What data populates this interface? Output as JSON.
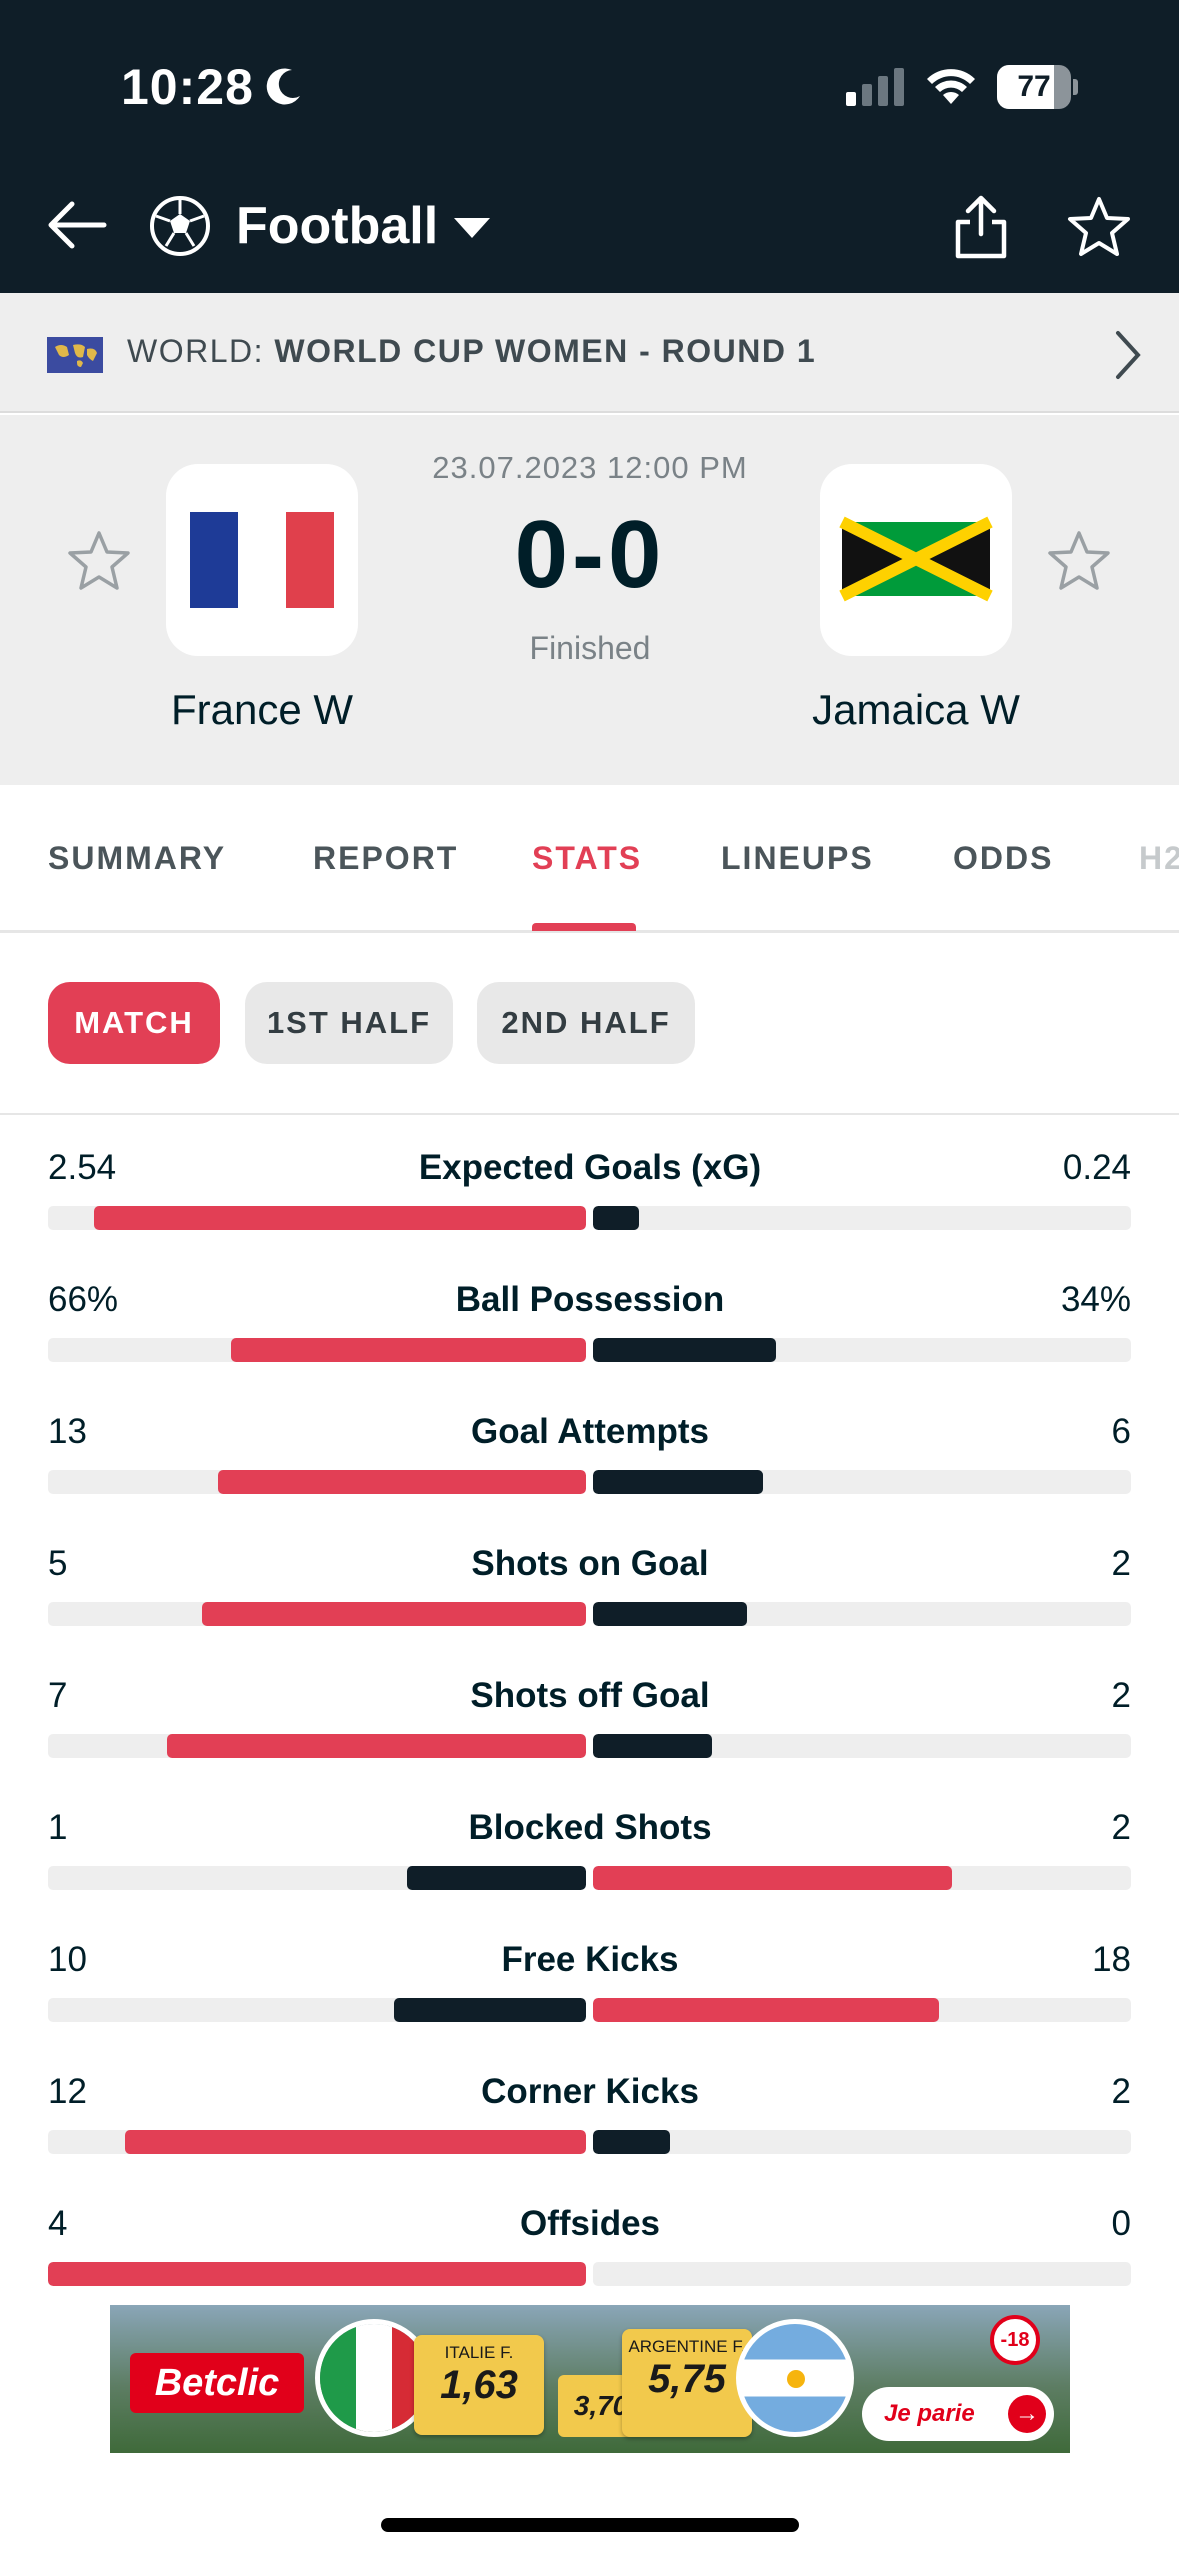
{
  "status_bar": {
    "time": "10:28",
    "battery": "77",
    "battery_level": 0.77
  },
  "header": {
    "sport": "Football"
  },
  "league": {
    "prefix": "WORLD:",
    "name": "WORLD CUP WOMEN - ROUND 1"
  },
  "match": {
    "date": "23.07.2023 12:00 PM",
    "score": "0-0",
    "status": "Finished",
    "home": {
      "name": "France W"
    },
    "away": {
      "name": "Jamaica W"
    }
  },
  "tabs": [
    {
      "label": "SUMMARY"
    },
    {
      "label": "REPORT"
    },
    {
      "label": "STATS"
    },
    {
      "label": "LINEUPS"
    },
    {
      "label": "ODDS"
    },
    {
      "label": "H2"
    }
  ],
  "periods": [
    {
      "label": "MATCH"
    },
    {
      "label": "1ST HALF"
    },
    {
      "label": "2ND HALF"
    }
  ],
  "stats": [
    {
      "label": "Expected Goals (xG)",
      "home": "2.54",
      "away": "0.24",
      "home_share": 0.914,
      "away_share": 0.086
    },
    {
      "label": "Ball Possession",
      "home": "66%",
      "away": "34%",
      "home_share": 0.66,
      "away_share": 0.34
    },
    {
      "label": "Goal Attempts",
      "home": "13",
      "away": "6",
      "home_share": 0.684,
      "away_share": 0.316
    },
    {
      "label": "Shots on Goal",
      "home": "5",
      "away": "2",
      "home_share": 0.714,
      "away_share": 0.286
    },
    {
      "label": "Shots off Goal",
      "home": "7",
      "away": "2",
      "home_share": 0.778,
      "away_share": 0.222
    },
    {
      "label": "Blocked Shots",
      "home": "1",
      "away": "2",
      "home_share": 0.333,
      "away_share": 0.667
    },
    {
      "label": "Free Kicks",
      "home": "10",
      "away": "18",
      "home_share": 0.357,
      "away_share": 0.643
    },
    {
      "label": "Corner Kicks",
      "home": "12",
      "away": "2",
      "home_share": 0.857,
      "away_share": 0.143
    },
    {
      "label": "Offsides",
      "home": "4",
      "away": "0",
      "home_share": 1.0,
      "away_share": 0.0
    }
  ],
  "ad": {
    "brand": "Betclic",
    "team1": "ITALIE F.",
    "odd1": "1,63",
    "draw": "3,70",
    "team2": "ARGENTINE F.",
    "odd2": "5,75",
    "age": "-18",
    "cta": "Je parie"
  },
  "colors": {
    "accent": "#e23f55",
    "dark": "#0f1e28",
    "track": "#eeeeee"
  }
}
